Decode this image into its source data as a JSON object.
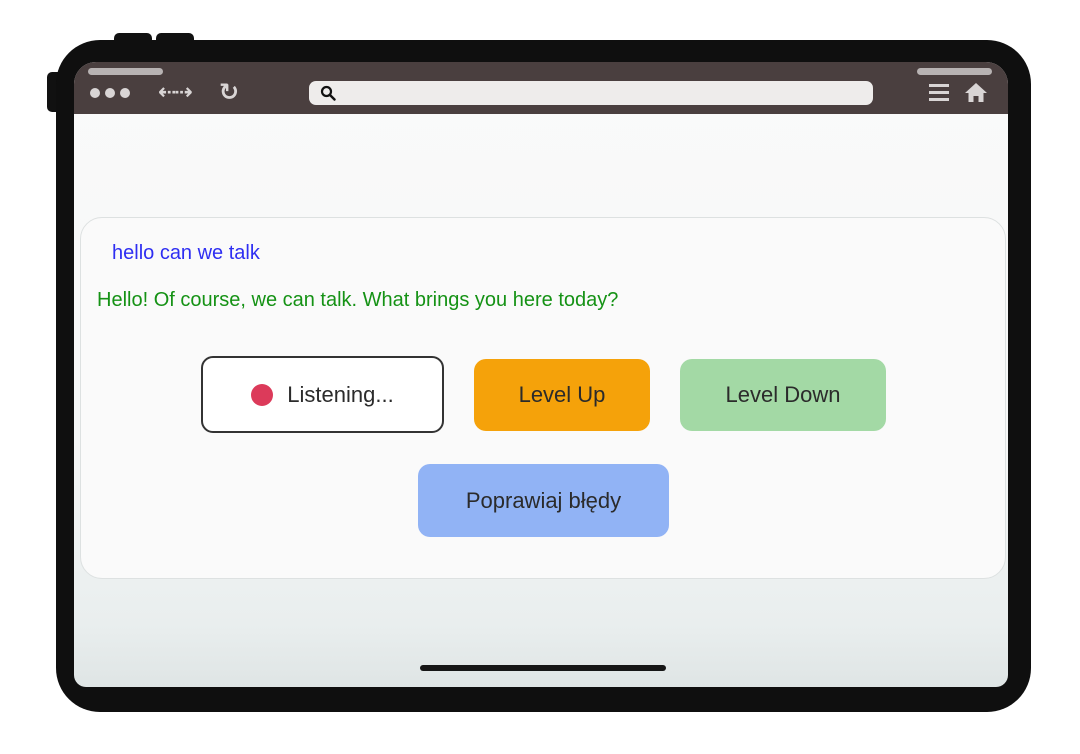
{
  "browser": {
    "search_placeholder": ""
  },
  "chat": {
    "user_message": "hello can we talk",
    "bot_message": "Hello! Of course, we can talk. What brings you here today?"
  },
  "controls": {
    "listening_label": "Listening...",
    "level_up_label": "Level Up",
    "level_down_label": "Level Down",
    "correct_errors_label": "Poprawiaj błędy"
  },
  "colors": {
    "user_text": "#2e2ef2",
    "bot_text": "#159215",
    "level_up": "#f5a20a",
    "level_down": "#a3d9a5",
    "correct_errors": "#91b3f5",
    "recording_dot": "#dc3a5a"
  }
}
